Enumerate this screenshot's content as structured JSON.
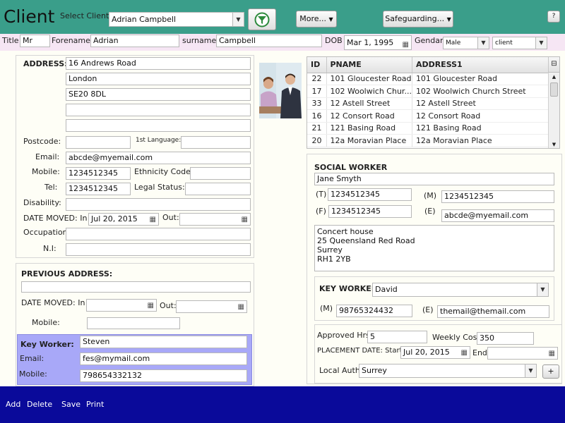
{
  "header": {
    "title": "Client",
    "select_client_label": "Select Client:",
    "selected_client": "Adrian  Campbell",
    "more_label": "More...",
    "safeguarding_label": "Safeguarding...",
    "help_label": "?"
  },
  "person": {
    "title_label": "Title",
    "title_value": "Mr",
    "forename_label": "Forename",
    "forename_value": "Adrian",
    "surname_label": "surname",
    "surname_value": "Campbell",
    "dob_label": "DOB",
    "dob_value": "Mar 1, 1995",
    "gender_label": "Gendar",
    "gender_value": "Male",
    "type_value": "client"
  },
  "address": {
    "label": "ADDRESS:",
    "line1": "16 Andrews Road",
    "line2": "London",
    "line3": "SE20 8DL",
    "line4": "",
    "line5": "",
    "postcode_label": "Postcode:",
    "postcode_value": "",
    "language_label": "1st Language:",
    "language_value": "",
    "email_label": "Email:",
    "email_value": "abcde@myemail.com",
    "mobile_label": "Mobile:",
    "mobile_value": "1234512345",
    "ethnicity_label": "Ethnicity Code:",
    "ethnicity_value": "",
    "tel_label": "Tel:",
    "tel_value": "1234512345",
    "legal_label": "Legal Status:",
    "legal_value": "",
    "disability_label": "Disability:",
    "disability_value": "",
    "moved_label": "DATE MOVED: In",
    "moved_in_value": "Jul 20, 2015",
    "out_label": "Out:",
    "moved_out_value": "",
    "occupation_label": "Occupation:",
    "occupation_value": "",
    "ni_label": "N.I:",
    "ni_value": ""
  },
  "previous": {
    "label": "PREVIOUS ADDRESS:",
    "address_value": "",
    "moved_label": "DATE MOVED: In",
    "moved_in_value": "",
    "out_label": "Out:",
    "moved_out_value": "",
    "mobile_label": "Mobile:",
    "mobile_value": ""
  },
  "key_worker_left": {
    "label": "Key Worker:",
    "name_value": "Steven",
    "email_label": "Email:",
    "email_value": "fes@mymail.com",
    "mobile_label": "Mobile:",
    "mobile_value": "798654332132"
  },
  "grid": {
    "columns": [
      "ID",
      "PNAME",
      "ADDRESS1"
    ],
    "rows": [
      {
        "id": "22",
        "pname": "101 Gloucester Road",
        "address1": "101 Gloucester Road"
      },
      {
        "id": "17",
        "pname": "102 Woolwich Chur...",
        "address1": "102 Woolwich Church Street"
      },
      {
        "id": "33",
        "pname": "12 Astell Street",
        "address1": "12 Astell Street"
      },
      {
        "id": "16",
        "pname": "12 Consort Road",
        "address1": "12 Consort Road"
      },
      {
        "id": "21",
        "pname": "121 Basing Road",
        "address1": "121 Basing Road"
      },
      {
        "id": "20",
        "pname": "12a Moravian Place",
        "address1": "12a Moravian Place"
      }
    ]
  },
  "social_worker": {
    "label": "SOCIAL WORKER",
    "name_value": "Jane Smyth",
    "t_label": "(T)",
    "t_value": "1234512345",
    "m_label": "(M)",
    "m_value": "1234512345",
    "f_label": "(F)",
    "f_value": "1234512345",
    "e_label": "(E)",
    "e_value": "abcde@myemail.com",
    "address_lines": [
      "Concert house",
      "25 Queensland Red Road",
      "Surrey",
      "RH1 2YB"
    ]
  },
  "key_worker_right": {
    "label": "KEY WORKER",
    "name_value": "David",
    "m_label": "(M)",
    "m_value": "98765324432",
    "e_label": "(E)",
    "e_value": "themail@themail.com"
  },
  "placement": {
    "hrs_label": "Approved Hrs",
    "hrs_value": "5",
    "cost_label": "Weekly Cost",
    "cost_value": "350",
    "date_label": "PLACEMENT DATE: Start",
    "start_value": "Jul 20, 2015",
    "end_label": "End",
    "end_value": "",
    "auth_label": "Local Auth",
    "auth_value": "Surrey",
    "add_label": "+"
  },
  "footer": {
    "add": "Add",
    "delete": "Delete",
    "save": "Save",
    "print": "Print"
  },
  "colors": {
    "header": "#3a9e8a",
    "subbar": "#f6e6f4",
    "footer": "#0a0a9a",
    "keyworker_panel": "#a8a8f8"
  }
}
